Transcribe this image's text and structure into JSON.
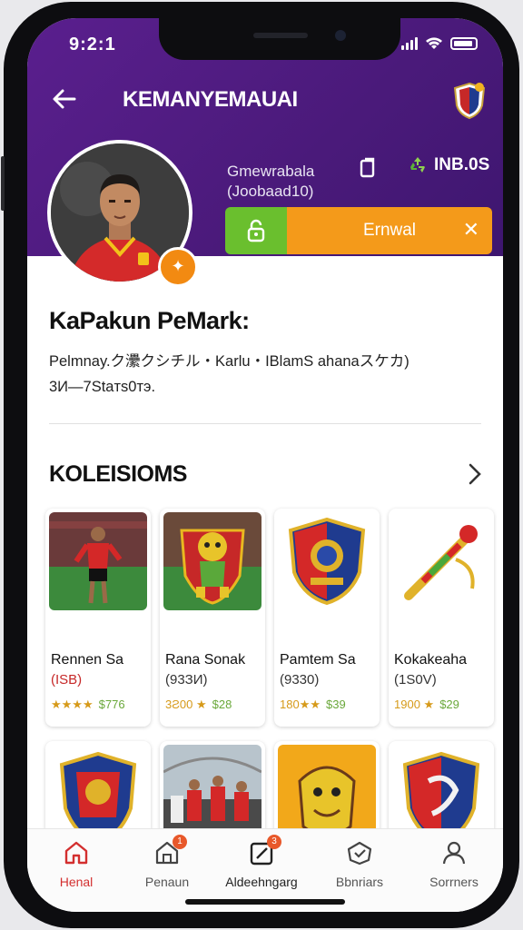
{
  "status": {
    "time": "9:2:1"
  },
  "header": {
    "title": "KEMANYEMAUAI"
  },
  "profile": {
    "stat_line1": "Gmewrabala",
    "stat_line2": "(Joobaad10)",
    "stat_count": "INB.0S",
    "follow_label": "Ernwal",
    "name": "KaPakun PeMark:",
    "bio_line1": "Pelmnay.ク㶟クシチル・Karlu・IBlamS ahanaスケカ)",
    "bio_line2": "3И—7Staтs0тэ."
  },
  "section": {
    "title": "KOLEISIOMS"
  },
  "cards": [
    {
      "title": "Rennen Sa",
      "price": "(ISB)",
      "stars": "★★★★",
      "price2": "$776"
    },
    {
      "title": "Rana Sonak",
      "price": "(93ЗИ)",
      "stars": "3Ƨ00 ★",
      "price2": "$28"
    },
    {
      "title": "Pamtem Sa",
      "price": "(9330)",
      "stars": "180★★",
      "price2": "$39"
    },
    {
      "title": "Kokakeaha",
      "price": "(1S0V)",
      "stars": "1900 ★",
      "price2": "$29"
    }
  ],
  "tabs": [
    {
      "label": "Henal",
      "badge": ""
    },
    {
      "label": "Penaun",
      "badge": "1"
    },
    {
      "label": "Aldeehngarg",
      "badge": "3"
    },
    {
      "label": "Bbnriars",
      "badge": ""
    },
    {
      "label": "Sorrners",
      "badge": ""
    }
  ],
  "colors": {
    "header_purple": "#4a1a7a",
    "accent_orange": "#f49a1a",
    "accent_green": "#6abf2e",
    "active_red": "#d32f2f"
  }
}
